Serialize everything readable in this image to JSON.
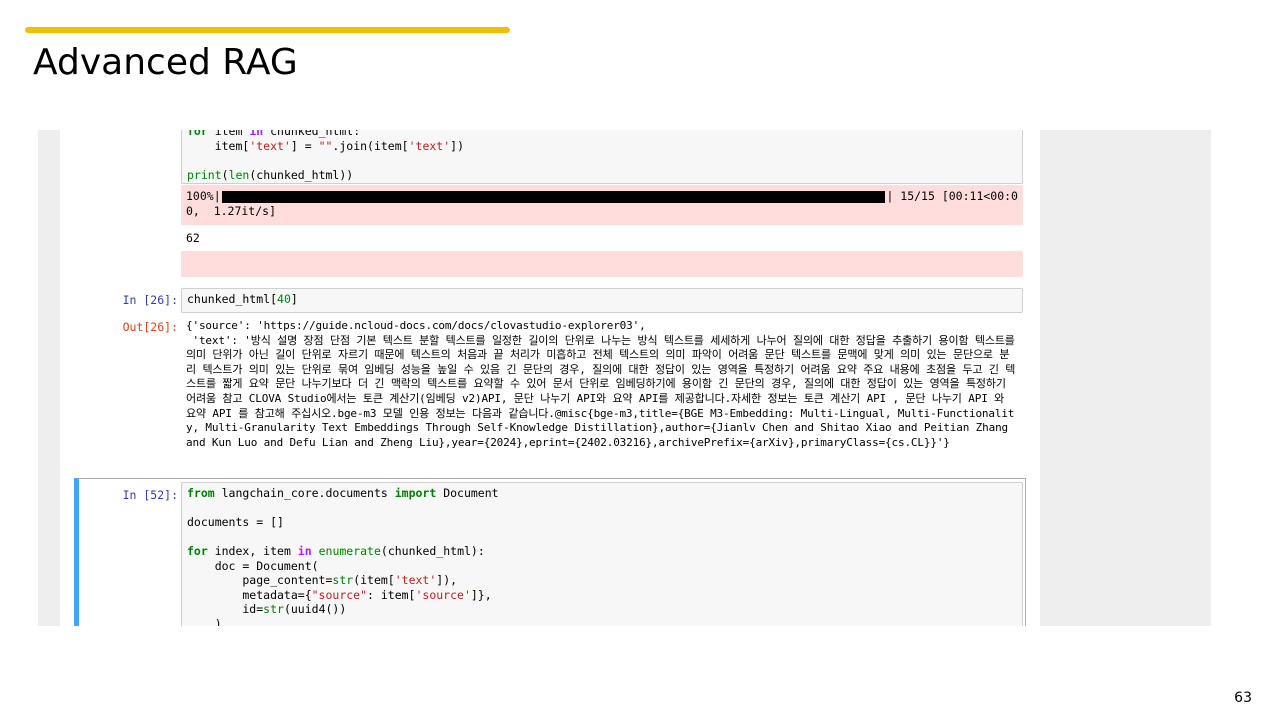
{
  "slide": {
    "title": "Advanced RAG",
    "page_number": "63"
  },
  "cells": {
    "cell1": {
      "code_line1": "for item in chunked_html:",
      "code_line2_pre": "    item[",
      "code_line2_str1": "'text'",
      "code_line2_mid": "] = ",
      "code_line2_str2": "\"\"",
      "code_line2_mid2": ".join(item[",
      "code_line2_str3": "'text'",
      "code_line2_end": "])",
      "code_line4_fn": "print",
      "code_line4_p1": "(",
      "code_line4_fn2": "len",
      "code_line4_rest": "(chunked_html))",
      "progress_prefix": "100%|",
      "progress_suffix": "| 15/15 [00:11<00:0",
      "progress_line2": "0,  1.27it/s]",
      "result": "62"
    },
    "cell2": {
      "in_prompt": "In [26]:",
      "code_pre": "chunked_html[",
      "code_num": "40",
      "code_end": "]",
      "out_prompt": "Out[26]:",
      "output": "{'source': 'https://guide.ncloud-docs.com/docs/clovastudio-explorer03',\n 'text': '방식 설명 장점 단점 기본 텍스트 분할 텍스트를 일정한 길이의 단위로 나누는 방식 텍스트를 세세하게 나누어 질의에 대한 정답을 추출하기 용이함 텍스트를 의미 단위가 아닌 길이 단위로 자르기 때문에 텍스트의 처음과 끝 처리가 미흡하고 전체 텍스트의 의미 파악이 어려움 문단 텍스트를 문맥에 맞게 의미 있는 문단으로 분리 텍스트가 의미 있는 단위로 묶여 임베딩 성능을 높일 수 있음 긴 문단의 경우, 질의에 대한 정답이 있는 영역을 특정하기 어려움 요약 주요 내용에 초점을 두고 긴 텍스트를 짧게 요약 문단 나누기보다 더 긴 맥락의 텍스트를 요약할 수 있어 문서 단위로 임베딩하기에 용이함 긴 문단의 경우, 질의에 대한 정답이 있는 영역을 특정하기 어려움 참고 CLOVA Studio에서는 토큰 계산기(임베딩 v2)API, 문단 나누기 API와 요약 API를 제공합니다.자세한 정보는 토큰 계산기 API , 문단 나누기 API 와 요약 API 를 참고해 주십시오.bge-m3 모델 인용 정보는 다음과 같습니다.@misc{bge-m3,title={BGE M3-Embedding: Multi-Lingual, Multi-Functionality, Multi-Granularity Text Embeddings Through Self-Knowledge Distillation},author={Jianlv Chen and Shitao Xiao and Peitian Zhang and Kun Luo and Defu Lian and Zheng Liu},year={2024},eprint={2402.03216},archivePrefix={arXiv},primaryClass={cs.CL}}'}"
    },
    "cell3": {
      "in_prompt": "In [52]:",
      "l1_from": "from",
      "l1_mod": " langchain_core.documents ",
      "l1_import": "import",
      "l1_name": " Document",
      "l3": "documents = []",
      "l5_for": "for",
      "l5_mid": " index, item ",
      "l5_in": "in",
      "l5_sp": " ",
      "l5_fn": "enumerate",
      "l5_end": "(chunked_html):",
      "l6": "    doc = Document(",
      "l7_pre": "        page_content=",
      "l7_fn": "str",
      "l7_mid": "(item[",
      "l7_str": "'text'",
      "l7_end": "]),",
      "l8_pre": "        metadata={",
      "l8_str1": "\"source\"",
      "l8_mid": ": item[",
      "l8_str2": "'source'",
      "l8_end": "]},",
      "l9_pre": "        id=",
      "l9_fn": "str",
      "l9_end": "(uuid4())",
      "l10": "    )"
    }
  }
}
